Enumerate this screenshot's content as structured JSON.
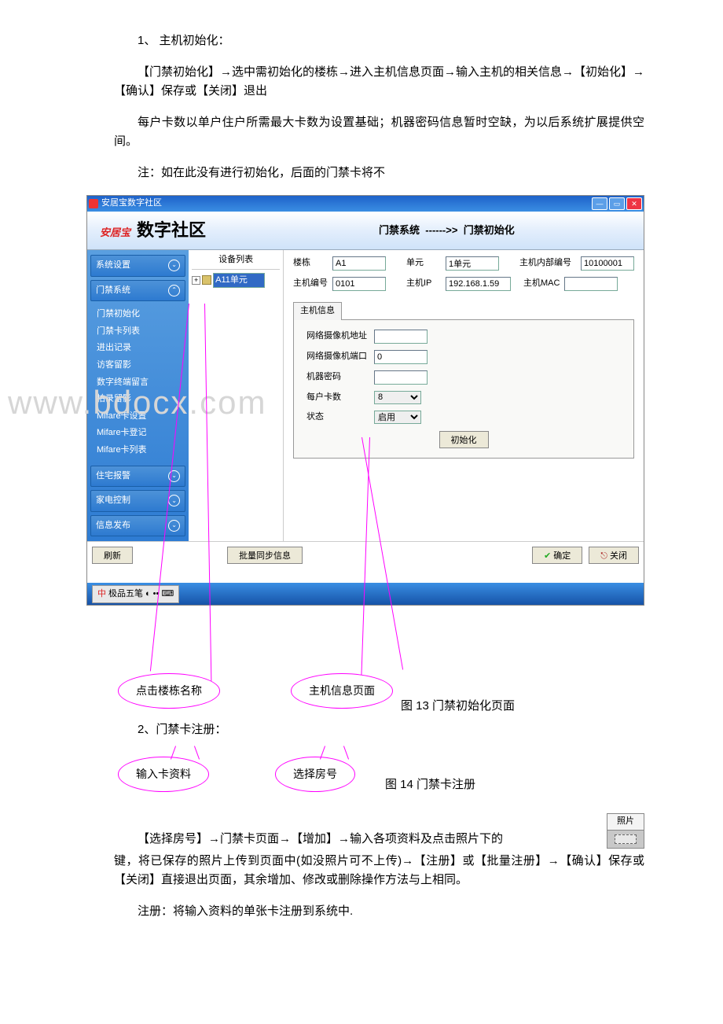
{
  "doc": {
    "p1_title": "1、 主机初始化：",
    "p2": "【门禁初始化】→选中需初始化的楼栋→进入主机信息页面→输入主机的相关信息→【初始化】→【确认】保存或【关闭】退出",
    "p3": "每户卡数以单户住户所需最大卡数为设置基础；机器密码信息暂时空缺，为以后系统扩展提供空间。",
    "p4": "注：如在此没有进行初始化，后面的门禁卡将不",
    "fig13": "图 13 门禁初始化页面",
    "p5_title": "2、门禁卡注册：",
    "fig14": "图 14 门禁卡注册",
    "p6a": "【选择房号】→门禁卡页面→【增加】→输入各项资料及点击照片下的",
    "p6b": "键，将已保存的照片上传到页面中(如没照片可不上传)→【注册】或【批量注册】→【确认】保存或【关闭】直接退出页面，其余增加、修改或删除操作方法与上相同。",
    "p7": "注册：将输入资料的单张卡注册到系统中.",
    "callout1": "点击楼栋名称",
    "callout2": "主机信息页面",
    "callout3": "输入卡资料",
    "callout4": "选择房号",
    "photo_label": "照片"
  },
  "app": {
    "title": "安居宝数字社区",
    "logo_brand": "安居宝",
    "logo_text": "数字社区",
    "breadcrumb_sys": "门禁系统",
    "breadcrumb_arrow": "------>>",
    "breadcrumb_page": "门禁初始化",
    "watermark": "www.bdocx.com",
    "sidebar": {
      "sec1": "系统设置",
      "sec2": "门禁系统",
      "items": [
        "门禁初始化",
        "门禁卡列表",
        "进出记录",
        "访客留影",
        "数字终端留言",
        "拍录留影",
        "Mifare卡设置",
        "Mifare卡登记",
        "Mifare卡列表"
      ],
      "sec3": "住宅报警",
      "sec4": "家电控制",
      "sec5": "信息发布"
    },
    "tree": {
      "header": "设备列表",
      "node": "A11单元",
      "plus": "+"
    },
    "form": {
      "l_building": "楼栋",
      "v_building": "A1",
      "l_unit": "单元",
      "v_unit": "1单元",
      "l_internal": "主机内部编号",
      "v_internal": "10100001",
      "l_hostno": "主机编号",
      "v_hostno": "0101",
      "l_ip": "主机IP",
      "v_ip": "192.168.1.59",
      "l_mac": "主机MAC",
      "v_mac": "",
      "tab": "主机信息",
      "l_camaddr": "网络摄像机地址",
      "v_camaddr": "",
      "l_camport": "网络摄像机端口",
      "v_camport": "0",
      "l_pwd": "机器密码",
      "v_pwd": "",
      "l_cards": "每户卡数",
      "v_cards": "8",
      "l_status": "状态",
      "v_status": "启用",
      "btn_init": "初始化"
    },
    "buttons": {
      "refresh": "刷新",
      "batch": "批量同步信息",
      "ok": "确定",
      "close": "关闭"
    },
    "taskbar": {
      "ime": "极品五笔"
    }
  }
}
